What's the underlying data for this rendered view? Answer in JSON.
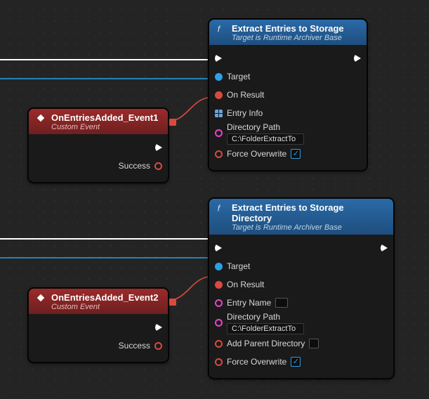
{
  "nodes": {
    "extract1": {
      "title": "Extract Entries to Storage",
      "subtitle": "Target is Runtime Archiver Base",
      "target_label": "Target",
      "onresult_label": "On Result",
      "entryinfo_label": "Entry Info",
      "dirpath_label": "Directory Path",
      "dirpath_value": "C:\\FolderExtractTo",
      "force_overwrite_label": "Force Overwrite",
      "force_overwrite_checked": true
    },
    "event1": {
      "title": "OnEntriesAdded_Event1",
      "subtitle": "Custom Event",
      "success_label": "Success"
    },
    "extract2": {
      "title": "Extract Entries to Storage Directory",
      "subtitle": "Target is Runtime Archiver Base",
      "target_label": "Target",
      "onresult_label": "On Result",
      "entryname_label": "Entry Name",
      "entryname_value": "",
      "dirpath_label": "Directory Path",
      "dirpath_value": "C:\\FolderExtractTo",
      "addparent_label": "Add Parent Directory",
      "addparent_checked": false,
      "force_overwrite_label": "Force Overwrite",
      "force_overwrite_checked": true
    },
    "event2": {
      "title": "OnEntriesAdded_Event2",
      "subtitle": "Custom Event",
      "success_label": "Success"
    }
  }
}
